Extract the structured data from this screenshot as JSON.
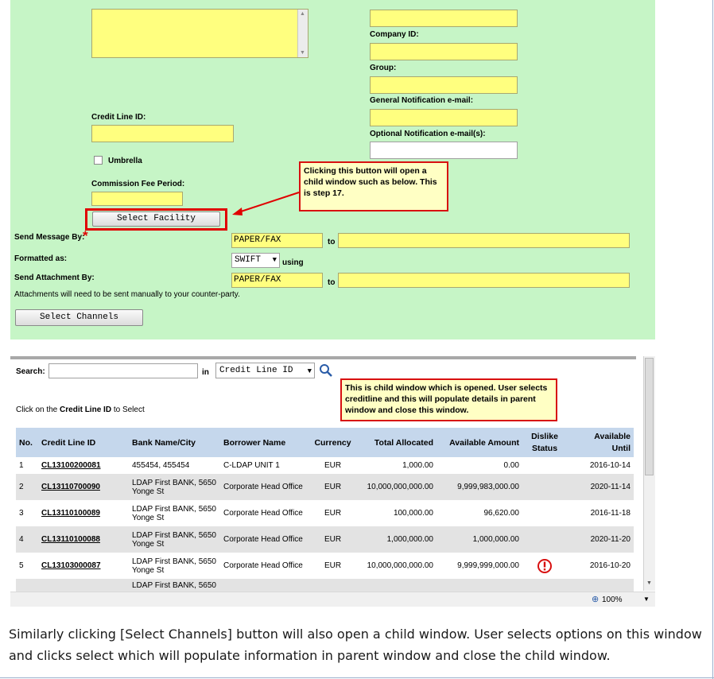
{
  "parent_form": {
    "company_id_label": "Company ID:",
    "group_label": "Group:",
    "general_email_label": "General Notification e-mail:",
    "optional_email_label": "Optional Notification e-mail(s):",
    "credit_line_id_label": "Credit Line ID:",
    "umbrella_label": "Umbrella",
    "commission_fee_label": "Commission Fee Period:",
    "select_facility_button": "Select Facility",
    "send_message_label": "Send Message By:",
    "required_mark": "*",
    "send_message_value": "PAPER/FAX",
    "to_label": "to",
    "formatted_as_label": "Formatted as:",
    "formatted_as_value": "SWIFT",
    "using_label": "using",
    "send_attachment_label": "Send Attachment By:",
    "send_attachment_value": "PAPER/FAX",
    "attachment_note": "Attachments will need to be sent manually to your counter-party.",
    "select_channels_button": "Select Channels"
  },
  "callout_parent": "Clicking this button will open a child window such as below. This is step 17.",
  "child_window": {
    "search_label": "Search:",
    "search_value": "",
    "in_label": "in",
    "search_field_value": "Credit Line ID",
    "instruction_prefix": "Click on the ",
    "instruction_bold": "Credit Line ID",
    "instruction_suffix": " to Select",
    "callout": "This is child window which is opened. User selects creditline and this will populate details in parent window and close this window.",
    "columns": {
      "no": "No.",
      "credit_line_id": "Credit Line ID",
      "bank": "Bank Name/City",
      "borrower": "Borrower Name",
      "currency": "Currency",
      "total": "Total Allocated",
      "available": "Available Amount",
      "dislike_1": "Dislike",
      "dislike_2": "Status",
      "until_1": "Available",
      "until_2": "Until"
    },
    "rows": [
      {
        "no": "1",
        "id": "CL13100200081",
        "bank": "455454,  455454",
        "borrower": "C-LDAP UNIT 1",
        "currency": "EUR",
        "total": "1,000.00",
        "available": "0.00",
        "until": "2016-10-14"
      },
      {
        "no": "2",
        "id": "CL13110700090",
        "bank": "LDAP First BANK,  5650 Yonge St",
        "borrower": "Corporate Head Office",
        "currency": "EUR",
        "total": "10,000,000,000.00",
        "available": "9,999,983,000.00",
        "until": "2020-11-14"
      },
      {
        "no": "3",
        "id": "CL13110100089",
        "bank": "LDAP First BANK,  5650 Yonge St",
        "borrower": "Corporate Head Office",
        "currency": "EUR",
        "total": "100,000.00",
        "available": "96,620.00",
        "until": "2016-11-18"
      },
      {
        "no": "4",
        "id": "CL13110100088",
        "bank": "LDAP First BANK,  5650 Yonge St",
        "borrower": "Corporate Head Office",
        "currency": "EUR",
        "total": "1,000,000.00",
        "available": "1,000,000.00",
        "until": "2020-11-20"
      },
      {
        "no": "5",
        "id": "CL13103000087",
        "bank": "LDAP First BANK,  5650 Yonge St",
        "borrower": "Corporate Head Office",
        "currency": "EUR",
        "total": "10,000,000,000.00",
        "available": "9,999,999,000.00",
        "until": "2016-10-20"
      }
    ],
    "partial_row_text": "LDAP First BANK,  5650",
    "zoom": "100%"
  },
  "caption": "Similarly clicking [Select Channels] button will also open a child window. User selects options on this window and clicks select which will populate information in parent window and close the child window.",
  "colors": {
    "form_bg": "#c6f5c6",
    "field_yellow": "#ffff7f",
    "callout_border": "#d81010",
    "table_header": "#c5d7ec",
    "alert_red": "#d81010"
  }
}
